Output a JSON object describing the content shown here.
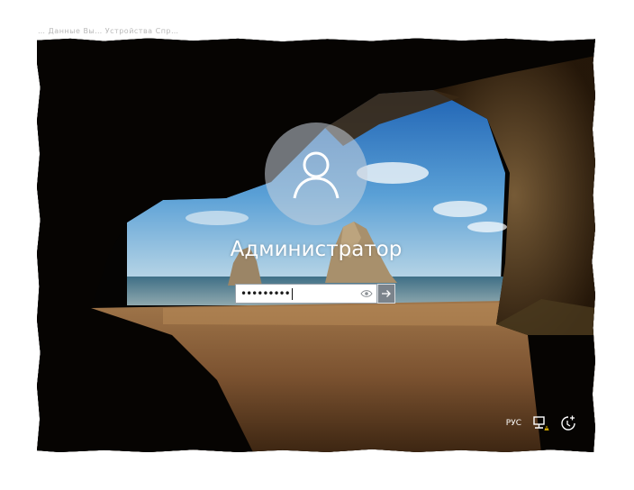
{
  "window": {
    "top_strip_text": "…  Данные   Вы…   Устройства   Спр…"
  },
  "login": {
    "username": "Администратор",
    "password_masked": "•••••••••",
    "user_icon": "user-avatar-icon",
    "reveal_icon": "eye-icon",
    "submit_icon": "arrow-right-icon"
  },
  "tray": {
    "language": "РУС",
    "network_icon": "network-warning-icon",
    "ease_of_access_icon": "ease-of-access-icon",
    "power_icon": "power-icon"
  },
  "colors": {
    "avatar_bg": "#c8d2dc",
    "submit_bg": "#7b838b",
    "text": "#ffffff"
  }
}
